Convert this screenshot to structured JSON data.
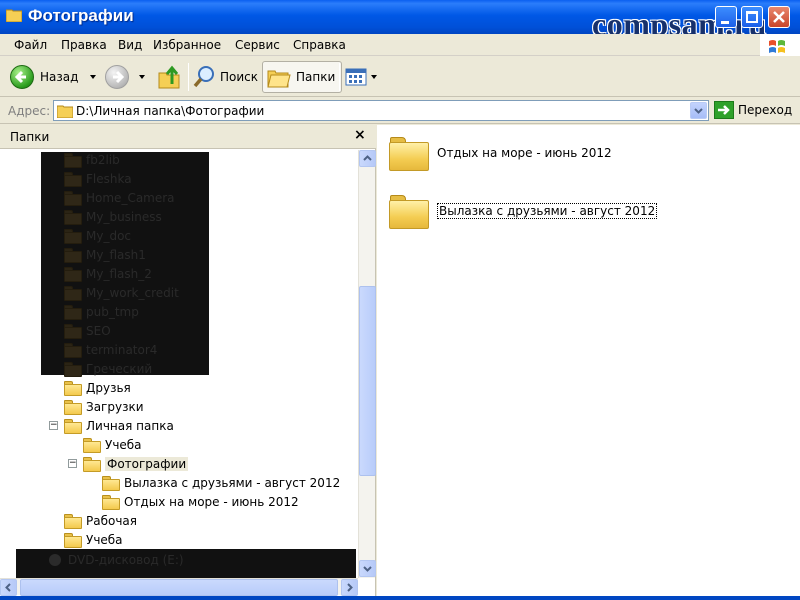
{
  "window": {
    "title": "Фотографии",
    "watermark": "compsam.ru"
  },
  "menu": {
    "items": [
      {
        "label": "Файл"
      },
      {
        "label": "Правка"
      },
      {
        "label": "Вид"
      },
      {
        "label": "Избранное"
      },
      {
        "label": "Сервис"
      },
      {
        "label": "Справка"
      }
    ]
  },
  "toolbar": {
    "back_label": "Назад",
    "search_label": "Поиск",
    "folders_label": "Папки"
  },
  "address": {
    "label": "Адрес:",
    "value": "D:\\Личная папка\\Фотографии",
    "go_label": "Переход"
  },
  "folders_pane": {
    "title": "Папки",
    "close_symbol": "×",
    "hidden_items": [
      "fb2lib",
      "Fleshka",
      "Home_Camera",
      "My_business",
      "My_doc",
      "My_flash1",
      "My_flash_2",
      "My_work_credit",
      "pub_tmp",
      "SEO",
      "terminator4",
      "Греческий"
    ],
    "tree": [
      {
        "label": "Друзья",
        "level": 1
      },
      {
        "label": "Загрузки",
        "level": 1
      },
      {
        "label": "Личная папка",
        "level": 1,
        "expander": "−"
      },
      {
        "label": "Учеба",
        "level": 2
      },
      {
        "label": "Фотографии",
        "level": 2,
        "expander": "−",
        "selected": true
      },
      {
        "label": "Вылазка с друзьями - август 2012",
        "level": 3
      },
      {
        "label": "Отдых на море - июнь 2012",
        "level": 3
      },
      {
        "label": "Рабочая",
        "level": 1
      },
      {
        "label": "Учеба",
        "level": 1
      }
    ],
    "bottom_hidden": [
      "DVD-дисковод (E:)"
    ]
  },
  "content": {
    "items": [
      {
        "label": "Отдых на море - июнь 2012"
      },
      {
        "label": "Вылазка с друзьями - август 2012",
        "focused": true
      }
    ]
  },
  "colors": {
    "titlebar": "#0058e6",
    "chrome": "#ece9d8",
    "folder": "#f3c94d"
  }
}
